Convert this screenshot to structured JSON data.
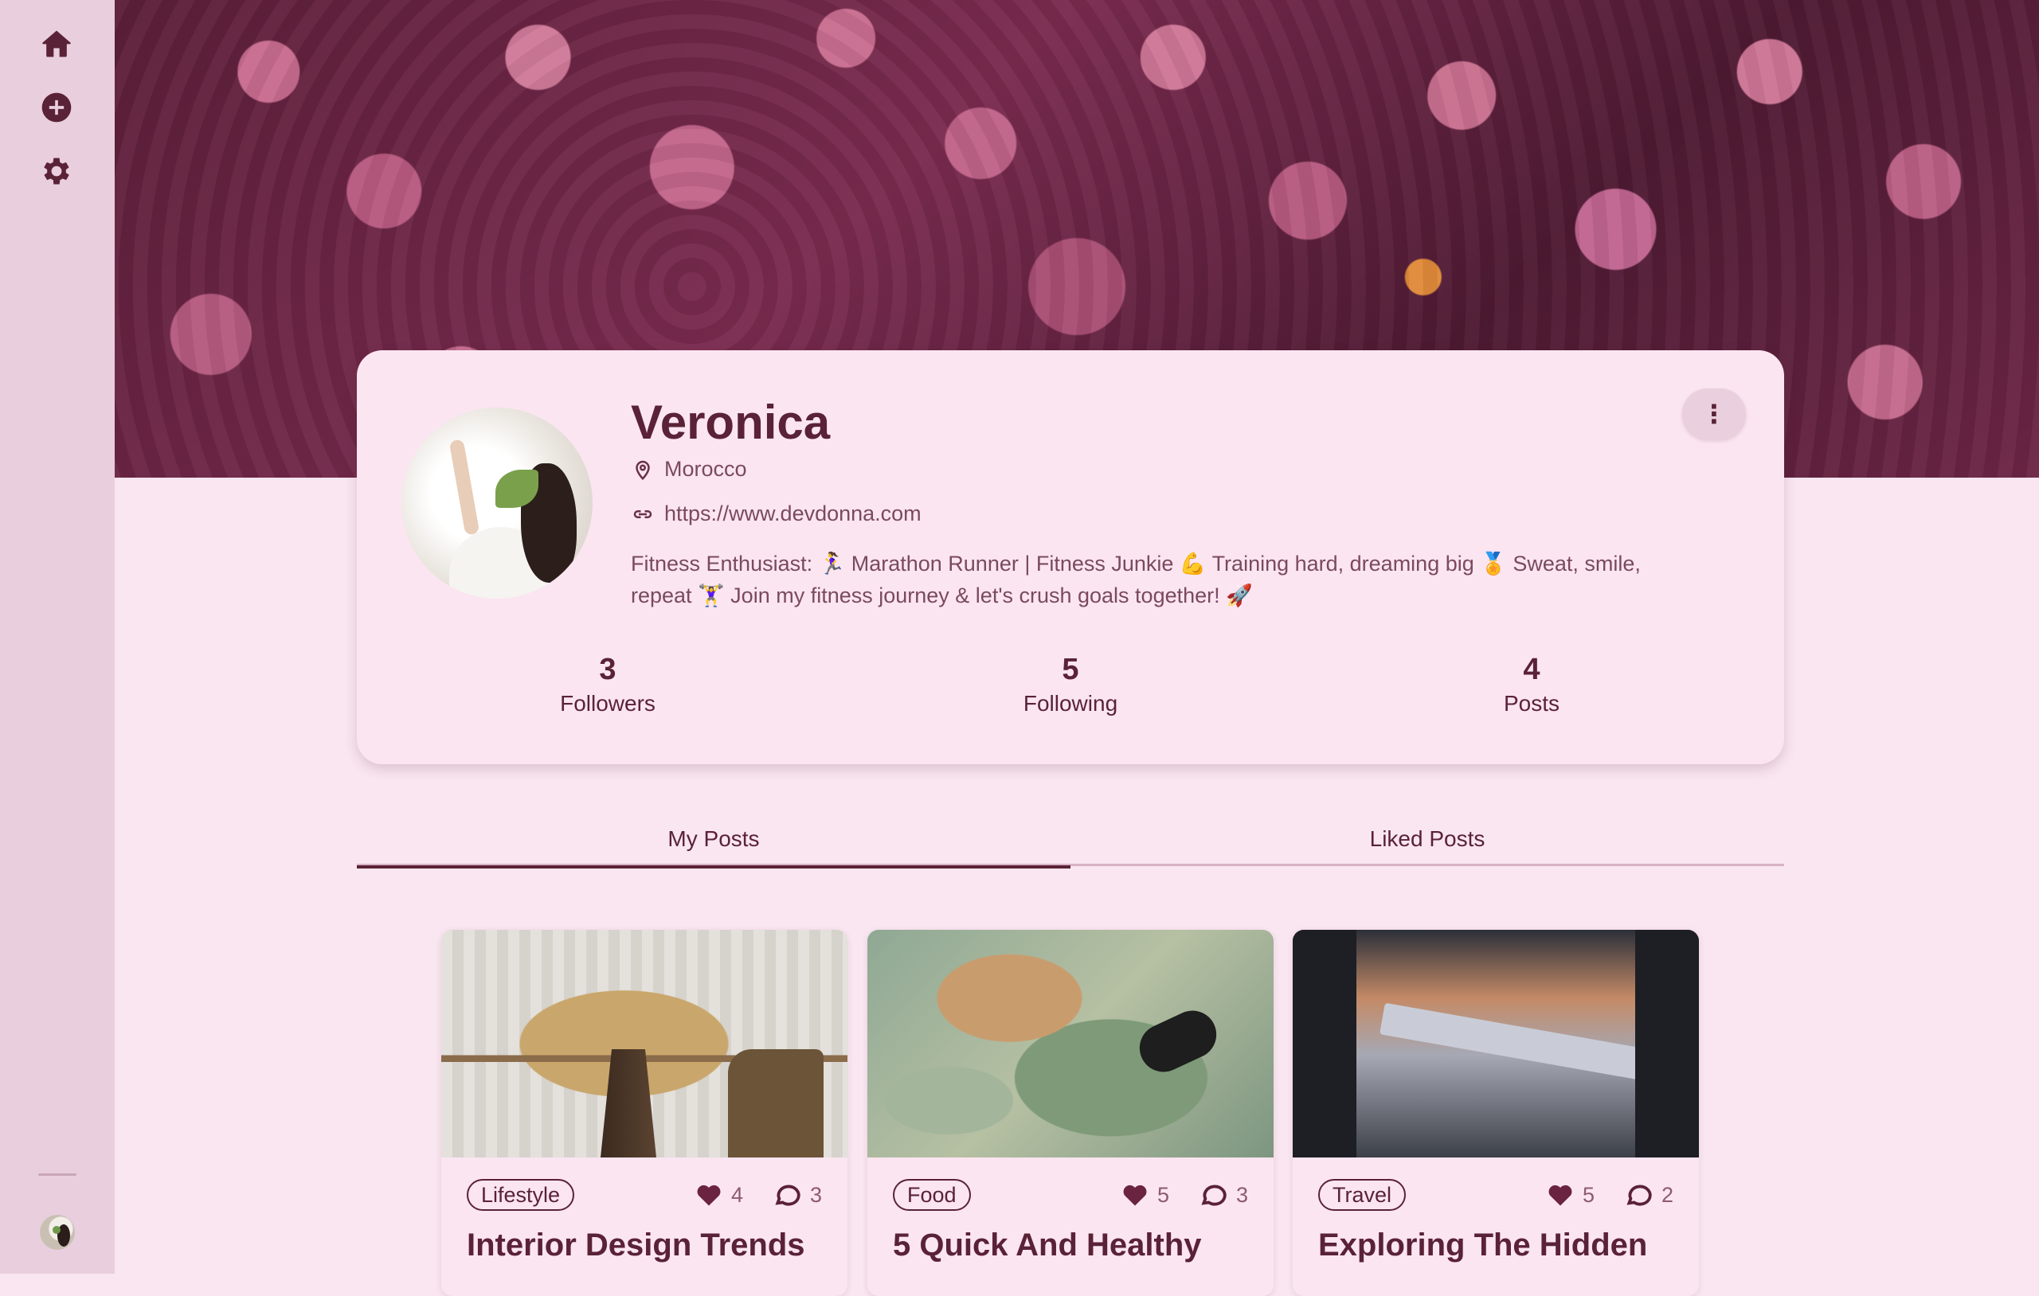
{
  "sidebar": {
    "icons": [
      "home-icon",
      "add-circle-icon",
      "settings-gear-icon"
    ]
  },
  "profile": {
    "name": "Veronica",
    "location": "Morocco",
    "website": "https://www.devdonna.com",
    "bio": "Fitness Enthusiast: 🏃‍♀️ Marathon Runner | Fitness Junkie 💪 Training hard, dreaming big 🏅 Sweat, smile, repeat 🏋️‍♀️ Join my fitness journey & let's crush goals together! 🚀",
    "more_label": "⋮",
    "stats": {
      "followers_count": "3",
      "followers_label": "Followers",
      "following_count": "5",
      "following_label": "Following",
      "posts_count": "4",
      "posts_label": "Posts"
    }
  },
  "tabs": {
    "my_posts": "My Posts",
    "liked_posts": "Liked Posts",
    "active": "my_posts"
  },
  "posts": [
    {
      "tag": "Lifestyle",
      "likes": "4",
      "comments": "3",
      "title": "Interior Design Trends"
    },
    {
      "tag": "Food",
      "likes": "5",
      "comments": "3",
      "title": "5 Quick And Healthy"
    },
    {
      "tag": "Travel",
      "likes": "5",
      "comments": "2",
      "title": "Exploring The Hidden"
    }
  ],
  "colors": {
    "primary": "#5a2236",
    "background": "#f9e6f1",
    "sidebar": "#e9cfdd",
    "card": "#fbe5f1"
  }
}
